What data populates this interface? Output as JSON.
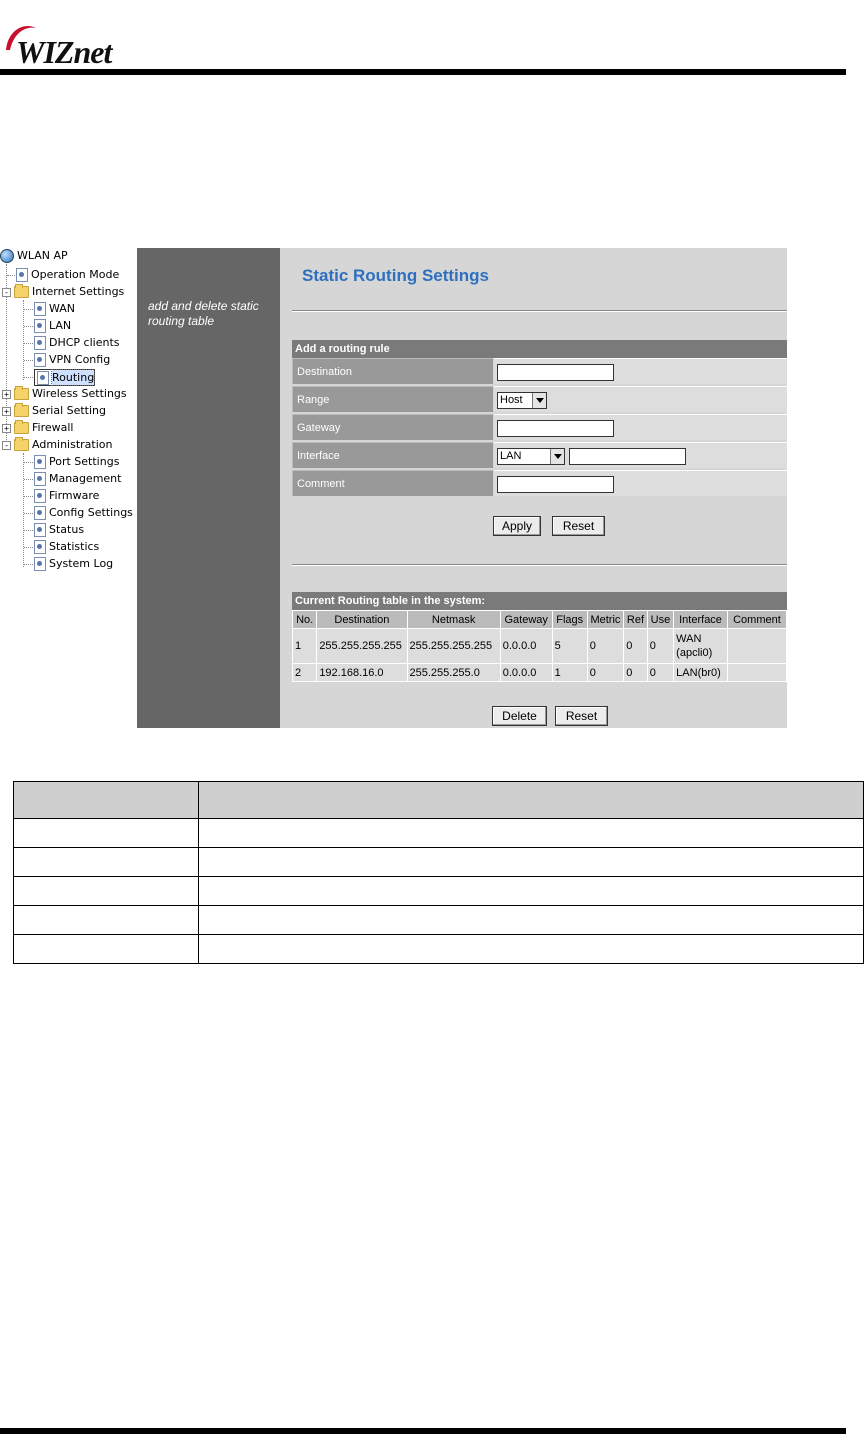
{
  "header": {
    "logo_text": "WIZnet"
  },
  "tree": {
    "root": "WLAN AP",
    "items": [
      {
        "label": "Operation Mode"
      },
      {
        "label": "Internet Settings"
      },
      {
        "label": "WAN"
      },
      {
        "label": "LAN"
      },
      {
        "label": "DHCP clients"
      },
      {
        "label": "VPN Config"
      },
      {
        "label": "Routing"
      },
      {
        "label": "Wireless Settings"
      },
      {
        "label": "Serial Setting"
      },
      {
        "label": "Firewall"
      },
      {
        "label": "Administration"
      },
      {
        "label": "Port Settings"
      },
      {
        "label": "Management"
      },
      {
        "label": "Firmware"
      },
      {
        "label": "Config Settings"
      },
      {
        "label": "Status"
      },
      {
        "label": "Statistics"
      },
      {
        "label": "System Log"
      }
    ]
  },
  "description": "add and delete static routing table",
  "main": {
    "title": "Static Routing Settings",
    "add_section": "Add a routing rule",
    "fields": {
      "destination": {
        "label": "Destination",
        "value": ""
      },
      "range": {
        "label": "Range",
        "value": "Host"
      },
      "gateway": {
        "label": "Gateway",
        "value": ""
      },
      "interface": {
        "label": "Interface",
        "value": "LAN",
        "custom": ""
      },
      "comment": {
        "label": "Comment",
        "value": ""
      }
    },
    "apply_label": "Apply",
    "reset_label": "Reset",
    "table_section": "Current Routing table in the system:",
    "table": {
      "headers": [
        "No.",
        "Destination",
        "Netmask",
        "Gateway",
        "Flags",
        "Metric",
        "Ref",
        "Use",
        "Interface",
        "Comment"
      ],
      "rows": [
        {
          "no": "1",
          "dest": "255.255.255.255",
          "mask": "255.255.255.255",
          "gw": "0.0.0.0",
          "flags": "5",
          "metric": "0",
          "ref": "0",
          "use": "0",
          "iface": "WAN\n(apcli0)",
          "comment": ""
        },
        {
          "no": "2",
          "dest": "192.168.16.0",
          "mask": "255.255.255.0",
          "gw": "0.0.0.0",
          "flags": "1",
          "metric": "0",
          "ref": "0",
          "use": "0",
          "iface": "LAN(br0)",
          "comment": ""
        }
      ]
    },
    "delete_label": "Delete",
    "reset2_label": "Reset"
  },
  "colors": {
    "title_blue": "#2f6fbf",
    "dark_pane": "#666666",
    "field_label_bg": "#999999",
    "section_header": "#7a7a7a"
  }
}
